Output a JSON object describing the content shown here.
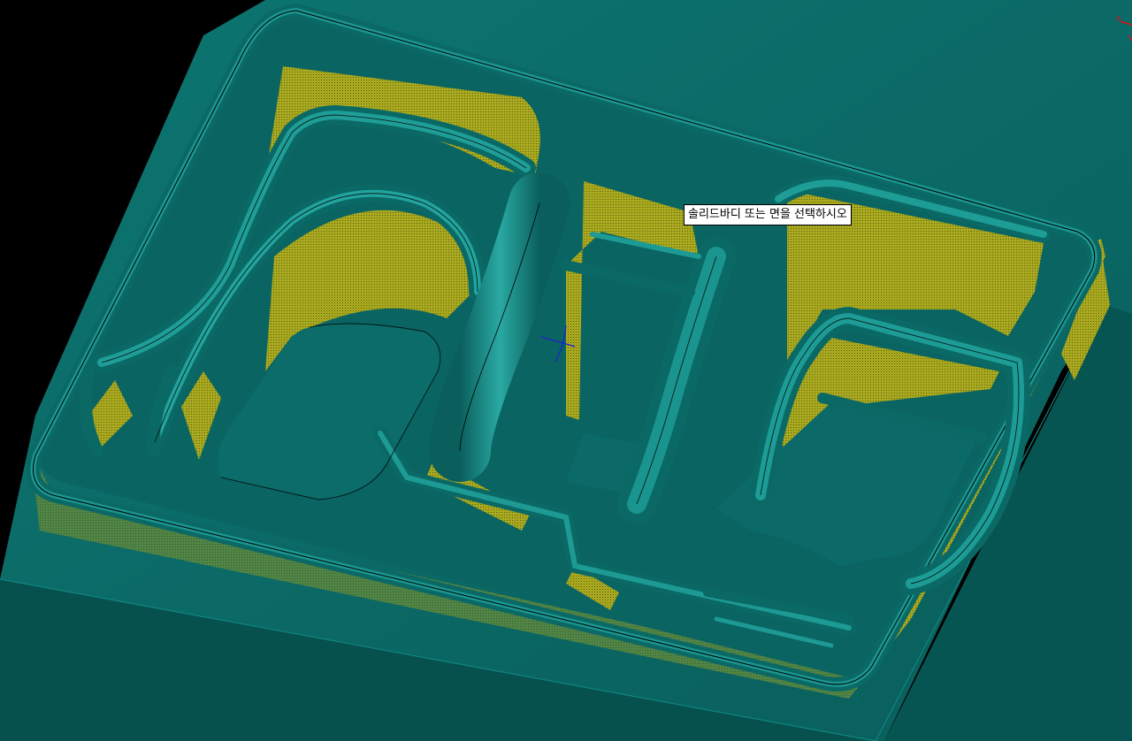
{
  "viewport": {
    "background": "#000000",
    "model_color": "#0b6a66",
    "model_highlight": "#1d9b96",
    "wall_color": "#a7a81e",
    "edge_color": "#000000",
    "axis_x_color": "#e01010",
    "axis_y_color": "#1a1ad0"
  },
  "tooltip": {
    "text": "솔리드바디 또는 면을 선택하시오"
  },
  "triad": {
    "x_label": "x"
  }
}
